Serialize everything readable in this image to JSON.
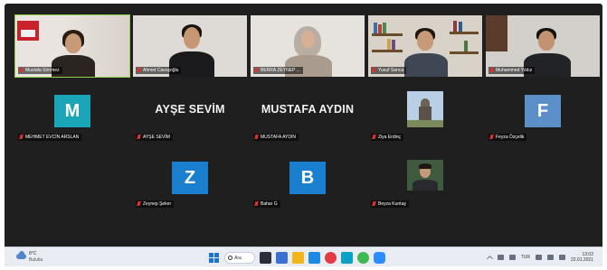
{
  "participants": [
    {
      "name": "Mustafa Sönmez"
    },
    {
      "name": "Ahmet Cavuşoğlu"
    },
    {
      "name": "BERRA ZEYNEP ..."
    },
    {
      "name": "Yusuf Sarıca"
    },
    {
      "name": "Muhammed Yıldız"
    },
    {
      "name": "MEHMET EVCİN ARSLAN",
      "initial": "M",
      "color": "#1aa5b8"
    },
    {
      "name": "AYŞE SEVİM",
      "display_name": "AYŞE SEVİM"
    },
    {
      "name": "MUSTAFA AYDIN",
      "display_name": "MUSTAFA AYDIN"
    },
    {
      "name": "Ziya Erdinç"
    },
    {
      "name": "Feyza Özçelik",
      "initial": "F",
      "color": "#5a8fc7"
    },
    {
      "name": "Zeynep Şeker",
      "initial": "Z",
      "color": "#1b7fcf"
    },
    {
      "name": "Bahar G",
      "initial": "B",
      "color": "#1b7fcf"
    },
    {
      "name": "Beyza Kuntaş"
    }
  ],
  "taskbar": {
    "weather_temp": "8°C",
    "weather_text": "Bulutlu",
    "search_label": "Ara",
    "language": "TUR",
    "time": "13:02",
    "date": "22.01.2021",
    "colors": {
      "accent": "#1a73d9"
    }
  }
}
